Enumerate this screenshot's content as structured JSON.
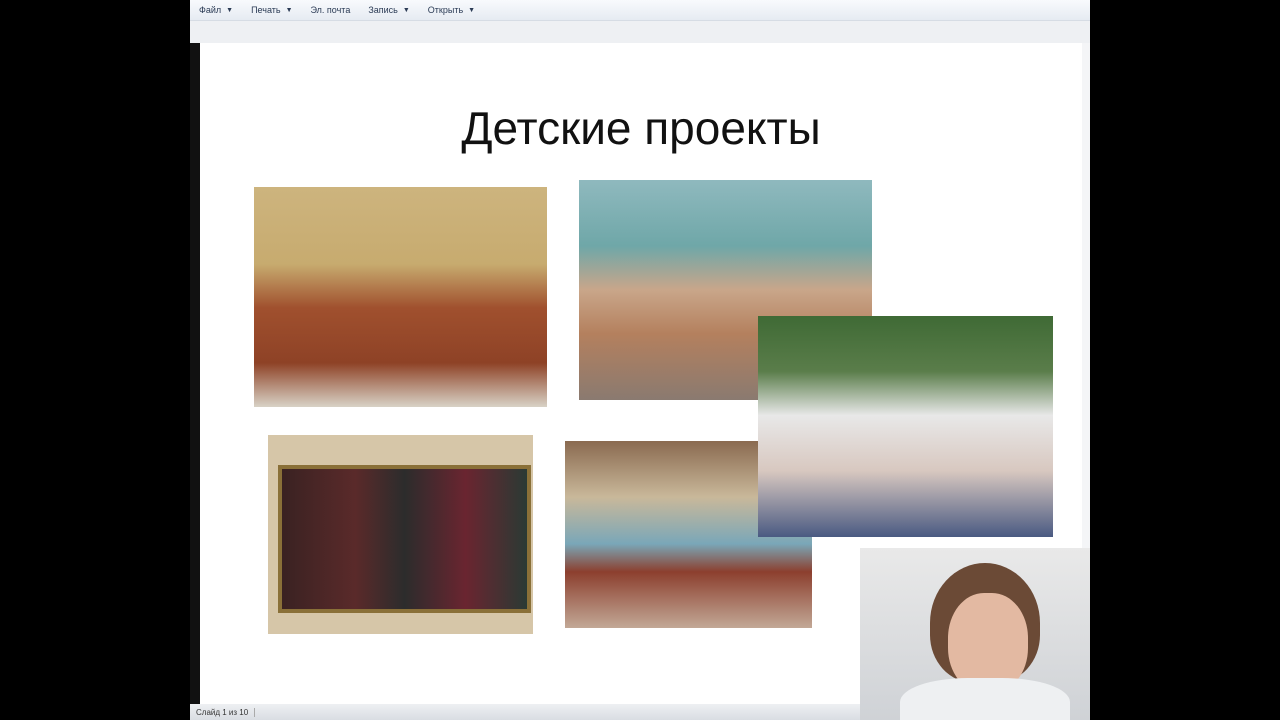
{
  "toolbar": {
    "items": [
      {
        "label": "Файл",
        "dropdown": true
      },
      {
        "label": "Печать",
        "dropdown": true
      },
      {
        "label": "Эл. почта",
        "dropdown": false
      },
      {
        "label": "Запись",
        "dropdown": true
      },
      {
        "label": "Открыть",
        "dropdown": true
      }
    ]
  },
  "slide": {
    "title": "Детские проекты"
  },
  "status": {
    "slide_indicator": "Слайд 1 из 10"
  }
}
